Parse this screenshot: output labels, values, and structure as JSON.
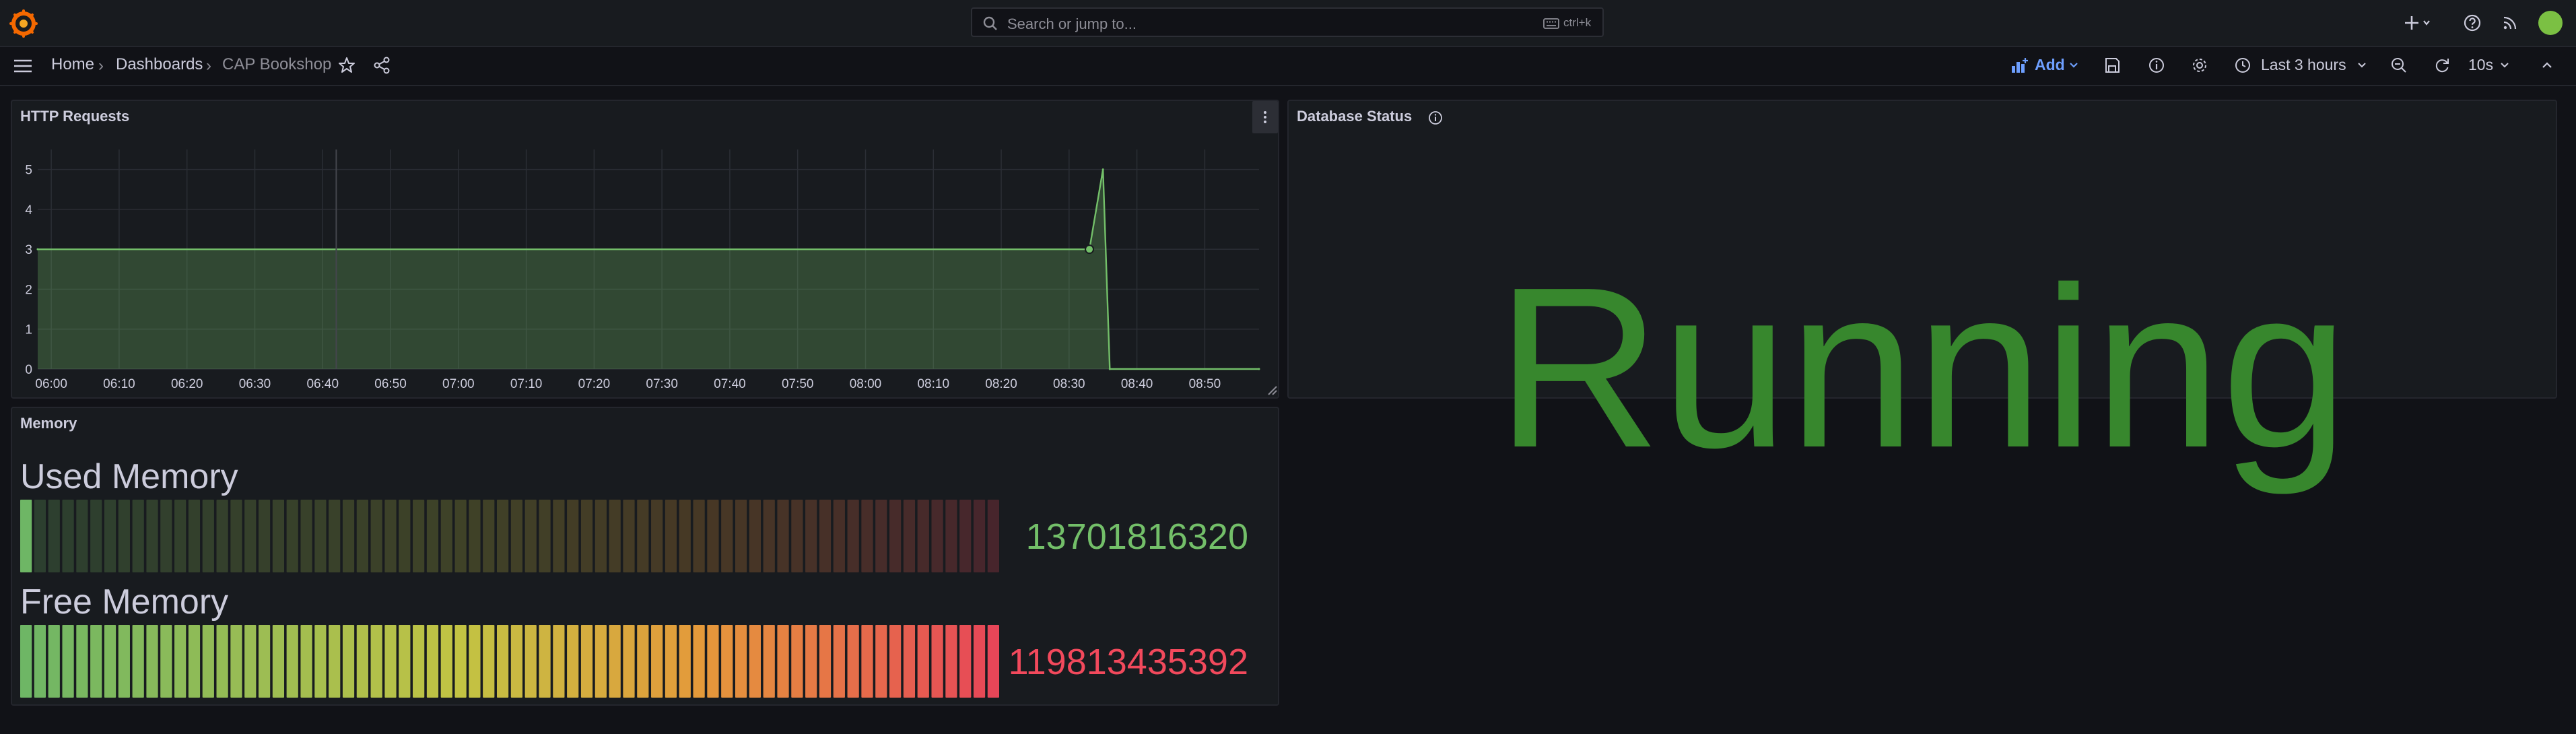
{
  "search": {
    "placeholder": "Search or jump to...",
    "shortcut": "ctrl+k"
  },
  "breadcrumb": {
    "home": "Home",
    "dashboards": "Dashboards",
    "current": "CAP Bookshop"
  },
  "toolbar": {
    "add_label": "Add",
    "time_range": "Last 3 hours",
    "refresh_interval": "10s"
  },
  "panels": {
    "http": {
      "title": "HTTP Requests"
    },
    "db": {
      "title": "Database Status",
      "value": "Running",
      "value_color": "#37872d"
    },
    "memory": {
      "title": "Memory",
      "used": {
        "label": "Used Memory",
        "value": "13701816320",
        "fill_fraction": 0.011,
        "color": "#73bf69"
      },
      "free": {
        "label": "Free Memory",
        "value": "119813435392",
        "fill_fraction": 1.0,
        "color": "#f2495c"
      }
    }
  },
  "chart_data": {
    "type": "area",
    "title": "HTTP Requests",
    "x_ticks": [
      "06:00",
      "06:10",
      "06:20",
      "06:30",
      "06:40",
      "06:50",
      "07:00",
      "07:10",
      "07:20",
      "07:30",
      "07:40",
      "07:50",
      "08:00",
      "08:10",
      "08:20",
      "08:30",
      "08:40",
      "08:50"
    ],
    "y_ticks": [
      "0",
      "1",
      "2",
      "3",
      "4",
      "5"
    ],
    "ylim": [
      0,
      5.5
    ],
    "series": [
      {
        "color": "#73bf69",
        "x": [
          "05:58",
          "08:33",
          "08:35",
          "08:36",
          "08:58"
        ],
        "y": [
          3,
          3,
          5,
          0,
          0
        ]
      }
    ],
    "grid": true
  },
  "colors": {
    "accent": "#6e9fff",
    "bg": "#111217",
    "panel": "#181b1f"
  }
}
